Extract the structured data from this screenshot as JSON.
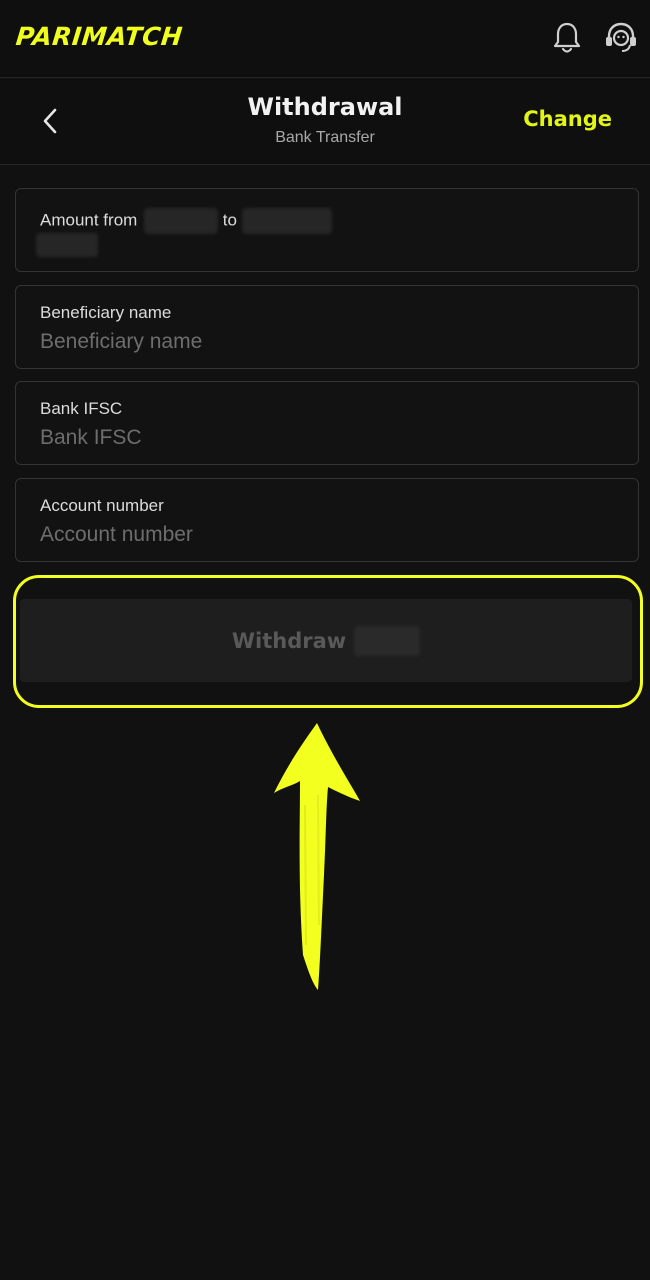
{
  "topbar": {
    "logo_text": "PARIMATCH",
    "icons": [
      "bell-icon",
      "support-headset-icon"
    ]
  },
  "header": {
    "back_icon": "chevron-left-icon",
    "title": "Withdrawal",
    "subtitle": "Bank Transfer",
    "change_label": "Change"
  },
  "form": {
    "amount": {
      "label_prefix": "Amount from",
      "label_mid": "to"
    },
    "beneficiary": {
      "label": "Beneficiary name",
      "placeholder": "Beneficiary name"
    },
    "ifsc": {
      "label": "Bank IFSC",
      "placeholder": "Bank IFSC"
    },
    "account": {
      "label": "Account number",
      "placeholder": "Account number"
    }
  },
  "withdraw_button": {
    "label": "Withdraw"
  },
  "colors": {
    "accent": "#f1ff1c",
    "background": "#111111",
    "button_bg": "#1e1e1e"
  }
}
